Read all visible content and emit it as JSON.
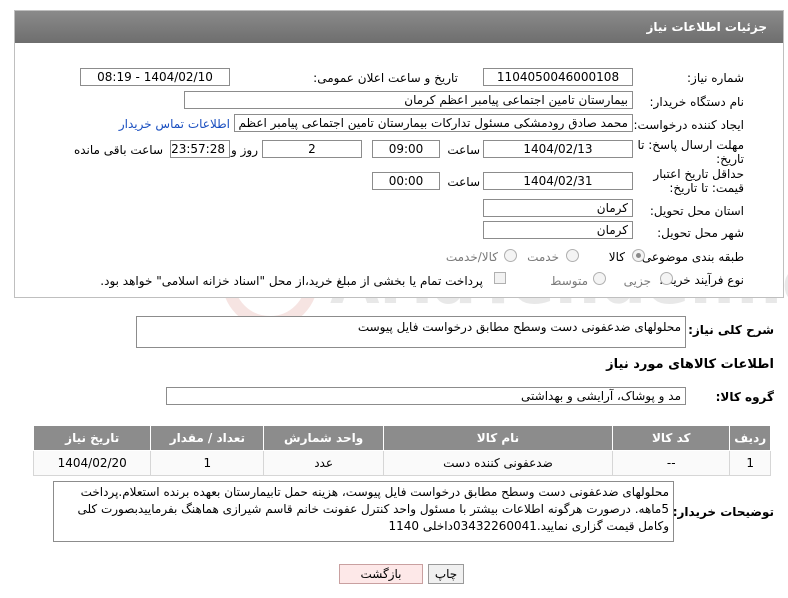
{
  "header": {
    "title": "جزئیات اطلاعات نیاز"
  },
  "form": {
    "need_number_label": "شماره نیاز:",
    "need_number": "1104050046000108",
    "announce_label": "تاریخ و ساعت اعلان عمومی:",
    "announce_value": "1404/02/10 - 08:19",
    "buyer_org_label": "نام دستگاه خریدار:",
    "buyer_org": "بیمارستان تامین اجتماعی پیامبر اعظم کرمان",
    "creator_label": "ایجاد کننده درخواست:",
    "creator": "محمد صادق  رودمشکی مسئول تدارکات بیمارستان تامین اجتماعی پیامبر اعظم",
    "contact_link": "اطلاعات تماس خریدار",
    "deadline_label": "مهلت ارسال پاسخ: تا تاریخ:",
    "deadline_date": "1404/02/13",
    "time_label": "ساعت",
    "deadline_time": "09:00",
    "days_value": "2",
    "days_label": "روز و",
    "remaining_time": "23:57:28",
    "remaining_label": "ساعت باقی مانده",
    "validity_label": "حداقل تاریخ اعتبار قیمت: تا تاریخ:",
    "validity_date": "1404/02/31",
    "validity_time": "00:00",
    "province_label": "استان محل تحویل:",
    "province": "کرمان",
    "city_label": "شهر محل تحویل:",
    "city": "کرمان",
    "category_label": "طبقه بندی موضوعی:",
    "category_options": [
      "کالا",
      "خدمت",
      "کالا/خدمت"
    ],
    "category_selected": "کالا",
    "process_label": "نوع فرآیند خرید :",
    "process_options": [
      "جزیی",
      "متوسط"
    ],
    "process_selected": "جزیی",
    "treasury_note": "پرداخت تمام یا بخشی از مبلغ خرید،از محل \"اسناد خزانه اسلامی\" خواهد بود."
  },
  "description": {
    "label": "شرح کلی نیاز:",
    "text": "محلولهای ضدعفونی دست وسطح مطابق درخواست فایل پیوست"
  },
  "goods": {
    "section_title": "اطلاعات کالاهای مورد نیاز",
    "group_label": "گروه کالا:",
    "group_value": "مد و پوشاک، آرایشی و بهداشتی",
    "columns": [
      "ردیف",
      "کد کالا",
      "نام کالا",
      "واحد شمارش",
      "تعداد / مقدار",
      "تاریخ نیاز"
    ],
    "rows": [
      {
        "index": "1",
        "code": "--",
        "name": "ضدعفونی کننده دست",
        "unit": "عدد",
        "qty": "1",
        "date": "1404/02/20"
      }
    ]
  },
  "buyer_notes": {
    "label": "توضیحات خریدار:",
    "text": "محلولهای ضدعفونی دست وسطح مطابق درخواست فایل پیوست، هزینه حمل تابیمارستان بعهده برنده استعلام.پرداخت 5ماهه. درصورت هرگونه اطلاعات بیشتر با مسئول واحد کنترل عفونت خانم قاسم شیرازی هماهنگ بفرماییدبصورت کلی وکامل قیمت گزاری نمایید.03432260041داخلی 1140"
  },
  "buttons": {
    "print": "چاپ",
    "back": "بازگشت"
  },
  "watermark": {
    "text": "AriaTender.net"
  }
}
